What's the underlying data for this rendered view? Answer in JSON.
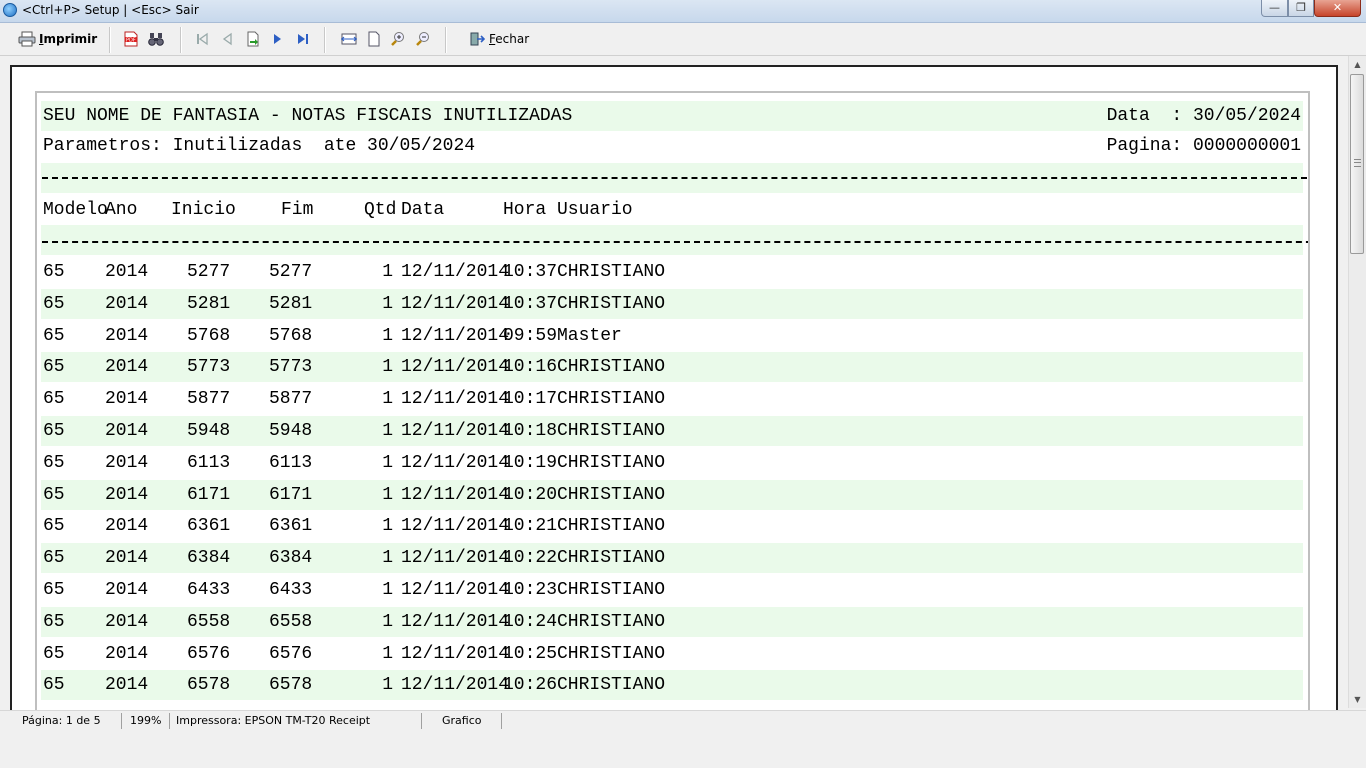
{
  "window": {
    "title": "<Ctrl+P> Setup | <Esc> Sair",
    "minimize_glyph": "—",
    "maximize_glyph": "❐",
    "close_glyph": "✕"
  },
  "toolbar": {
    "print_label_first": "I",
    "print_label_rest": "mprimir",
    "close_label_first": "F",
    "close_label_rest": "echar",
    "icons": [
      "printer-icon",
      "pdf-icon",
      "binoculars-icon",
      "first-page-icon",
      "previous-page-icon",
      "goto-page-icon",
      "next-page-icon",
      "last-page-icon",
      "page-width-icon",
      "whole-page-icon",
      "zoom-in-icon",
      "zoom-out-icon",
      "exit-door-icon"
    ]
  },
  "report": {
    "title": "SEU NOME DE FANTASIA - NOTAS FISCAIS INUTILIZADAS",
    "parameters": "Parametros: Inutilizadas  ate 30/05/2024",
    "date_label": "Data  : 30/05/2024",
    "page_label": "Pagina: 0000000001",
    "columns": {
      "modelo": "Modelo",
      "ano": "Ano",
      "inicio": "Inicio",
      "fim": "Fim",
      "qtd": "Qtd",
      "data": "Data",
      "hora": "Hora",
      "usuario": "Usuario"
    },
    "rows": [
      {
        "modelo": "65",
        "ano": "2014",
        "inicio": "5277",
        "fim": "5277",
        "qtd": "1",
        "data": "12/11/2014",
        "hora": "10:37",
        "usuario": "CHRISTIANO"
      },
      {
        "modelo": "65",
        "ano": "2014",
        "inicio": "5281",
        "fim": "5281",
        "qtd": "1",
        "data": "12/11/2014",
        "hora": "10:37",
        "usuario": "CHRISTIANO"
      },
      {
        "modelo": "65",
        "ano": "2014",
        "inicio": "5768",
        "fim": "5768",
        "qtd": "1",
        "data": "12/11/2014",
        "hora": "09:59",
        "usuario": "Master"
      },
      {
        "modelo": "65",
        "ano": "2014",
        "inicio": "5773",
        "fim": "5773",
        "qtd": "1",
        "data": "12/11/2014",
        "hora": "10:16",
        "usuario": "CHRISTIANO"
      },
      {
        "modelo": "65",
        "ano": "2014",
        "inicio": "5877",
        "fim": "5877",
        "qtd": "1",
        "data": "12/11/2014",
        "hora": "10:17",
        "usuario": "CHRISTIANO"
      },
      {
        "modelo": "65",
        "ano": "2014",
        "inicio": "5948",
        "fim": "5948",
        "qtd": "1",
        "data": "12/11/2014",
        "hora": "10:18",
        "usuario": "CHRISTIANO"
      },
      {
        "modelo": "65",
        "ano": "2014",
        "inicio": "6113",
        "fim": "6113",
        "qtd": "1",
        "data": "12/11/2014",
        "hora": "10:19",
        "usuario": "CHRISTIANO"
      },
      {
        "modelo": "65",
        "ano": "2014",
        "inicio": "6171",
        "fim": "6171",
        "qtd": "1",
        "data": "12/11/2014",
        "hora": "10:20",
        "usuario": "CHRISTIANO"
      },
      {
        "modelo": "65",
        "ano": "2014",
        "inicio": "6361",
        "fim": "6361",
        "qtd": "1",
        "data": "12/11/2014",
        "hora": "10:21",
        "usuario": "CHRISTIANO"
      },
      {
        "modelo": "65",
        "ano": "2014",
        "inicio": "6384",
        "fim": "6384",
        "qtd": "1",
        "data": "12/11/2014",
        "hora": "10:22",
        "usuario": "CHRISTIANO"
      },
      {
        "modelo": "65",
        "ano": "2014",
        "inicio": "6433",
        "fim": "6433",
        "qtd": "1",
        "data": "12/11/2014",
        "hora": "10:23",
        "usuario": "CHRISTIANO"
      },
      {
        "modelo": "65",
        "ano": "2014",
        "inicio": "6558",
        "fim": "6558",
        "qtd": "1",
        "data": "12/11/2014",
        "hora": "10:24",
        "usuario": "CHRISTIANO"
      },
      {
        "modelo": "65",
        "ano": "2014",
        "inicio": "6576",
        "fim": "6576",
        "qtd": "1",
        "data": "12/11/2014",
        "hora": "10:25",
        "usuario": "CHRISTIANO"
      },
      {
        "modelo": "65",
        "ano": "2014",
        "inicio": "6578",
        "fim": "6578",
        "qtd": "1",
        "data": "12/11/2014",
        "hora": "10:26",
        "usuario": "CHRISTIANO"
      }
    ]
  },
  "statusbar": {
    "page": "Página: 1 de 5",
    "zoom": "199%",
    "printer": "Impressora: EPSON TM-T20 Receipt",
    "mode": "Grafico"
  },
  "colors": {
    "band": "#eafaea",
    "title_bar": "#c7d8ec",
    "close_button": "#c7442a"
  }
}
